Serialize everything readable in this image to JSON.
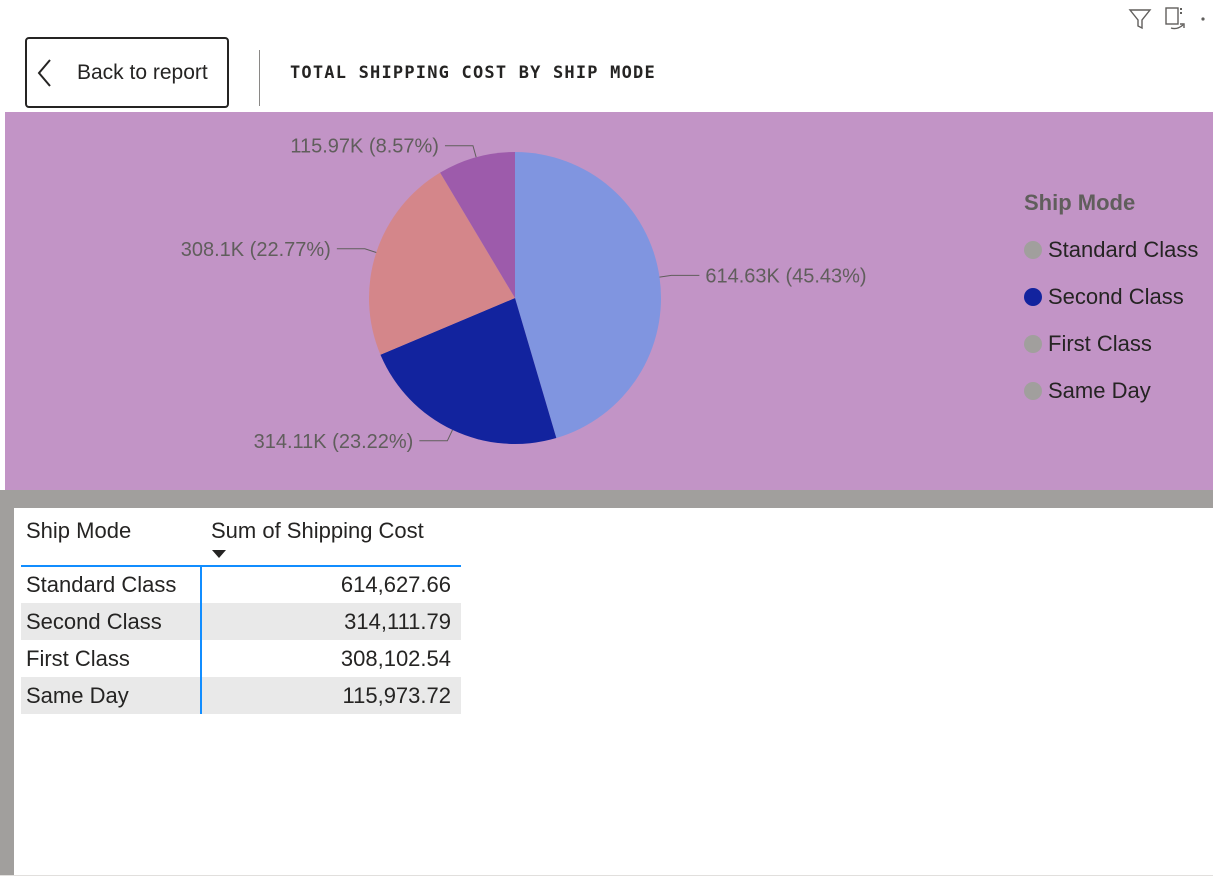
{
  "header": {
    "back_label": "Back to report",
    "visual_title": "TOTAL SHIPPING COST BY SHIP MODE",
    "icons": [
      "filter-icon",
      "focus-mode-icon",
      "more-options-icon"
    ]
  },
  "colors": {
    "chart_background": "#c294c6",
    "standard_class": "#8095e0",
    "second_class": "#12239e",
    "first_class": "#d4868a",
    "same_day": "#9d5bab",
    "legend_inactive": "#a19f9d",
    "table_accent": "#118dff"
  },
  "chart_data": {
    "type": "pie",
    "categories": [
      "Standard Class",
      "Second Class",
      "First Class",
      "Same Day"
    ],
    "values": [
      614627.66,
      314111.79,
      308102.54,
      115973.72
    ],
    "percentages": [
      45.43,
      23.22,
      22.77,
      8.57
    ],
    "data_labels": [
      "614.63K (45.43%)",
      "314.11K (23.22%)",
      "308.1K (22.77%)",
      "115.97K (8.57%)"
    ],
    "legend_title": "Ship Mode",
    "legend_placement": "right",
    "highlighted": "Second Class"
  },
  "legend": {
    "title": "Ship Mode",
    "items": [
      {
        "label": "Standard Class",
        "state": "inactive"
      },
      {
        "label": "Second Class",
        "state": "active"
      },
      {
        "label": "First Class",
        "state": "inactive"
      },
      {
        "label": "Same Day",
        "state": "inactive"
      }
    ]
  },
  "table": {
    "columns": [
      "Ship Mode",
      "Sum of Shipping Cost"
    ],
    "sort_column": "Sum of Shipping Cost",
    "rows": [
      [
        "Standard Class",
        "614,627.66"
      ],
      [
        "Second Class",
        "314,111.79"
      ],
      [
        "First Class",
        "308,102.54"
      ],
      [
        "Same Day",
        "115,973.72"
      ]
    ]
  }
}
